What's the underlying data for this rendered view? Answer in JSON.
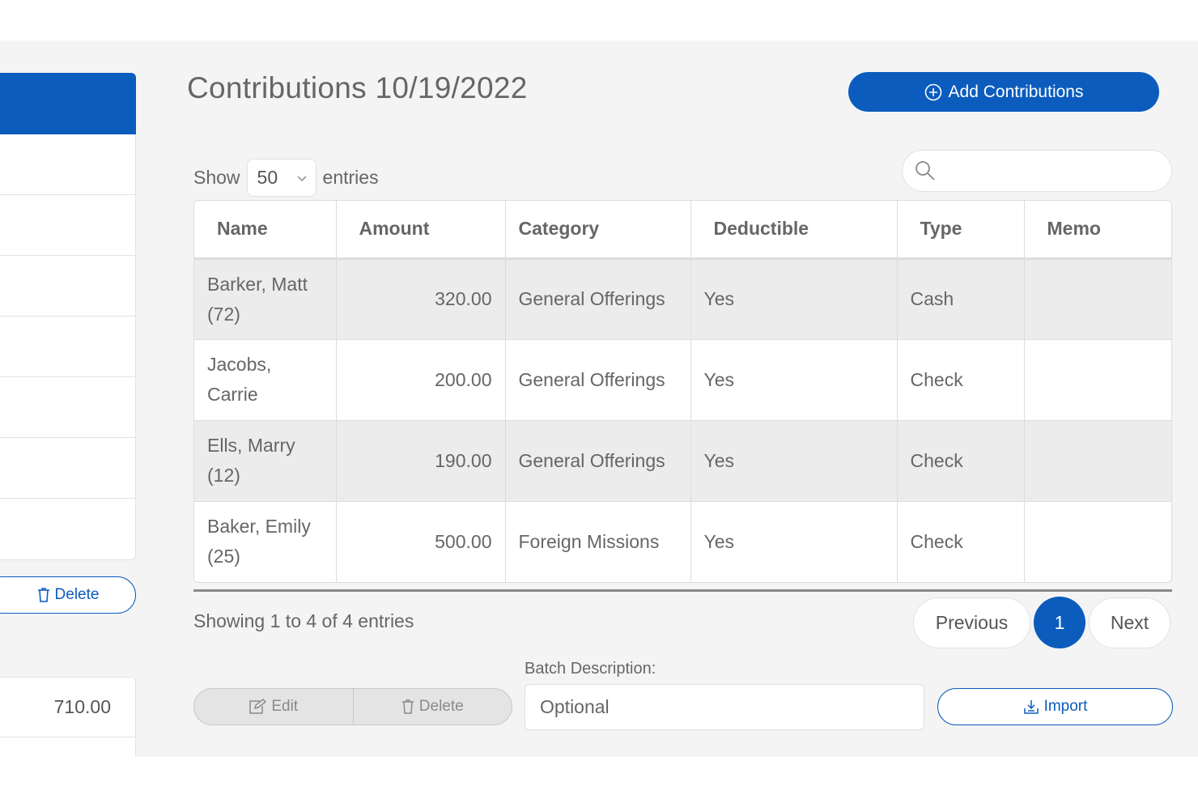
{
  "page": {
    "title": "Contributions 10/19/2022"
  },
  "header": {
    "add_label": "Add Contributions"
  },
  "length_menu": {
    "show_label": "Show",
    "value": "50",
    "entries_label": "entries"
  },
  "search": {
    "placeholder": ""
  },
  "table": {
    "columns": [
      "Name",
      "Amount",
      "Category",
      "Deductible",
      "Type",
      "Memo"
    ],
    "rows": [
      {
        "name": "Barker, Matt (72)",
        "amount": "320.00",
        "category": "General Offerings",
        "deductible": "Yes",
        "type": "Cash",
        "memo": ""
      },
      {
        "name": "Jacobs, Carrie",
        "amount": "200.00",
        "category": "General Offerings",
        "deductible": "Yes",
        "type": "Check",
        "memo": ""
      },
      {
        "name": "Ells, Marry (12)",
        "amount": "190.00",
        "category": "General Offerings",
        "deductible": "Yes",
        "type": "Check",
        "memo": ""
      },
      {
        "name": "Baker, Emily (25)",
        "amount": "500.00",
        "category": "Foreign Missions",
        "deductible": "Yes",
        "type": "Check",
        "memo": ""
      }
    ]
  },
  "info": {
    "text": "Showing 1 to 4 of 4 entries"
  },
  "pagination": {
    "previous": "Previous",
    "current": "1",
    "next": "Next"
  },
  "batch": {
    "label": "Batch Description:",
    "placeholder": "Optional"
  },
  "actions": {
    "edit": "Edit",
    "delete": "Delete",
    "import": "Import"
  },
  "left_panel": {
    "delete_label": "Delete",
    "total": "710.00"
  },
  "colors": {
    "accent": "#0b5cbd",
    "stripe": "#ececec",
    "background": "#f4f4f4"
  }
}
